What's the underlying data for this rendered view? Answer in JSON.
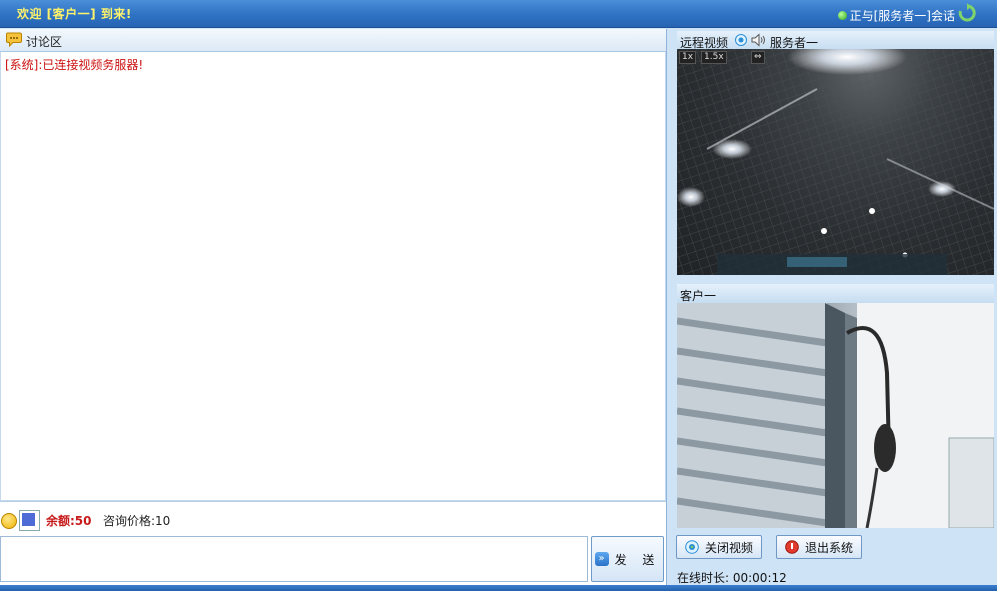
{
  "header": {
    "welcome": "欢迎 [客户一] 到来!",
    "session_status": "正与[服务者一]会话"
  },
  "chat": {
    "panel_title": "讨论区",
    "messages": [
      {
        "text": "[系统]:已连接视频务服器!",
        "color": "#cc1111"
      }
    ],
    "balance_label": "余额:50",
    "price_label": "咨询价格:10",
    "input_value": "",
    "send_label": "发 送",
    "font_color": "#4f6bd6"
  },
  "video": {
    "remote_title": "远程视频",
    "remote_peer": "服务者一",
    "zoom_1x": "1x",
    "zoom_15x": "1.5x",
    "local_title": "客户一"
  },
  "actions": {
    "close_video": "关闭视频",
    "exit_system": "退出系统"
  },
  "status": {
    "online_time": "在线时长: 00:00:12"
  },
  "icons": {
    "session_dot": "green-status-dot",
    "refresh": "refresh-icon",
    "chat": "chat-bubble-icon",
    "camera": "camera-icon",
    "speaker": "speaker-icon",
    "smile": "smile-icon",
    "send": "double-arrow-icon",
    "close_video": "camera-icon",
    "exit": "power-icon"
  }
}
